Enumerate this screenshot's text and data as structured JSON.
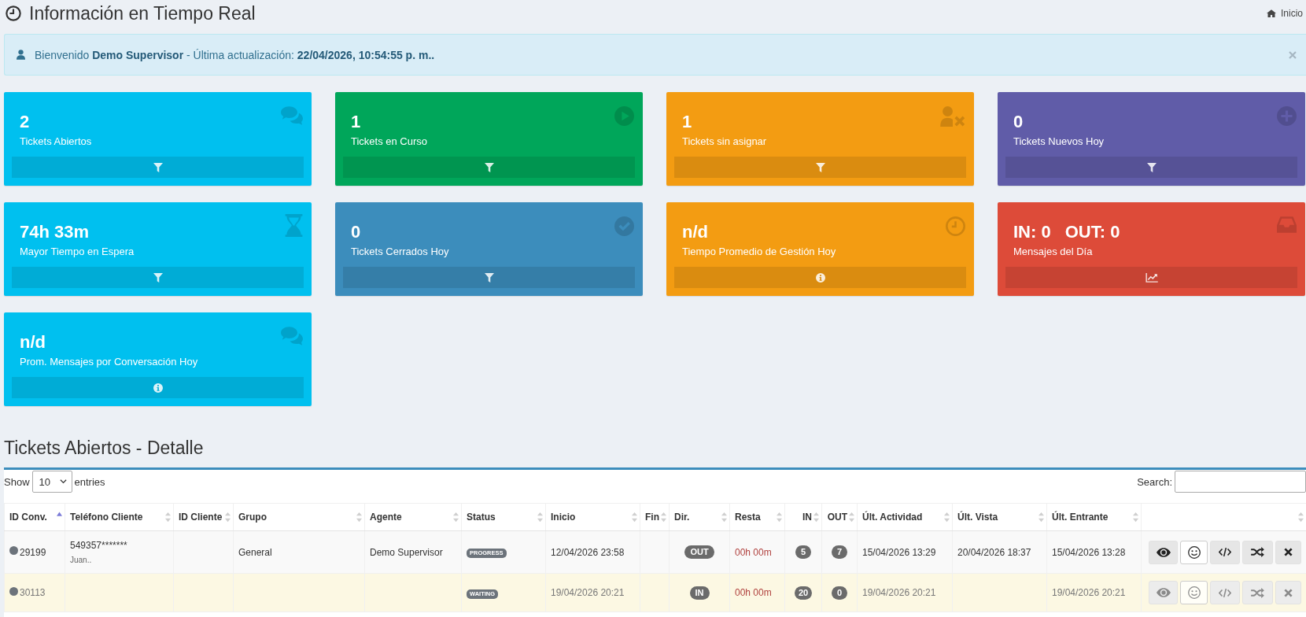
{
  "header": {
    "title": "Información en Tiempo Real",
    "breadcrumb": "Inicio"
  },
  "alert": {
    "message": "Bienvenido **Demo Supervisor** - Última actualización: **22/04/2026, 10:54:55 p. m..**"
  },
  "cards": [
    {
      "values": [
        "2"
      ],
      "label": "Tickets Abiertos",
      "color": "#00c0ef",
      "kind": "filter"
    },
    {
      "values": [
        "1"
      ],
      "label": "Tickets en Curso",
      "color": "#00a65a",
      "kind": "filter"
    },
    {
      "values": [
        "1"
      ],
      "label": "Tickets sin asignar",
      "color": "#f39c12",
      "kind": "filter"
    },
    {
      "values": [
        "0"
      ],
      "label": "Tickets Nuevos Hoy",
      "color": "#605ca8",
      "kind": "filter"
    },
    {
      "values": [
        "74h 33m"
      ],
      "label": "Mayor Tiempo en Espera",
      "color": "#00c0ef",
      "kind": "filter"
    },
    {
      "values": [
        "0"
      ],
      "label": "Tickets Cerrados Hoy",
      "color": "#3c8dbc",
      "kind": "filter"
    },
    {
      "values": [
        "n/d"
      ],
      "label": "Tiempo Promedio de Gestión Hoy",
      "color": "#f39c12",
      "kind": "info"
    },
    {
      "values": [
        "IN: 0",
        "OUT: 0"
      ],
      "label": "Mensajes del Día",
      "color": "#dd4b39",
      "kind": "chart"
    },
    {
      "values": [
        "n/d"
      ],
      "label": "Prom. Mensajes por Conversación Hoy",
      "color": "#00c0ef",
      "kind": "info"
    }
  ],
  "section_title": "Tickets Abiertos - Detalle",
  "table_controls": {
    "show_label": "Show",
    "page_size": "10",
    "entries_label": "entries",
    "search_label": "Search:"
  },
  "table": {
    "columns": [
      {
        "label": "ID Conv.",
        "sorted": true
      },
      {
        "label": "Teléfono Cliente",
        "sorted": false
      },
      {
        "label": "ID Cliente",
        "sorted": false
      },
      {
        "label": "Grupo",
        "sorted": false
      },
      {
        "label": "Agente",
        "sorted": false
      },
      {
        "label": "Status",
        "sorted": false
      },
      {
        "label": "Inicio",
        "sorted": false
      },
      {
        "label": "Fin",
        "sorted": false
      },
      {
        "label": "Dir.",
        "sorted": false
      },
      {
        "label": "Resta",
        "sorted": false
      },
      {
        "label": "IN",
        "sorted": false
      },
      {
        "label": "OUT",
        "sorted": false
      },
      {
        "label": "Últ. Actividad",
        "sorted": false
      },
      {
        "label": "Últ. Vista",
        "sorted": false
      },
      {
        "label": "Últ. Entrante",
        "sorted": false
      },
      {
        "sorted": false
      }
    ],
    "rows": [
      {
        "highlighted": false,
        "id": "29199",
        "phone": "549357*******",
        "client_name": "Juan..",
        "group": "General",
        "agent": "Demo Supervisor",
        "status": "PROGRESS",
        "start": "12/04/2026 23:58",
        "direction": "OUT",
        "remaining": "00h 00m",
        "in": "5",
        "out": "7",
        "last_activity": "15/04/2026 13:29",
        "last_view": "20/04/2026 18:37",
        "last_incoming": "15/04/2026 13:28"
      },
      {
        "highlighted": true,
        "id": "30113",
        "status": "WAITING",
        "start": "19/04/2026 20:21",
        "direction": "IN",
        "remaining": "00h 00m",
        "in": "20",
        "out": "0",
        "last_activity": "19/04/2026 20:21",
        "last_incoming": "19/04/2026 20:21"
      }
    ]
  }
}
